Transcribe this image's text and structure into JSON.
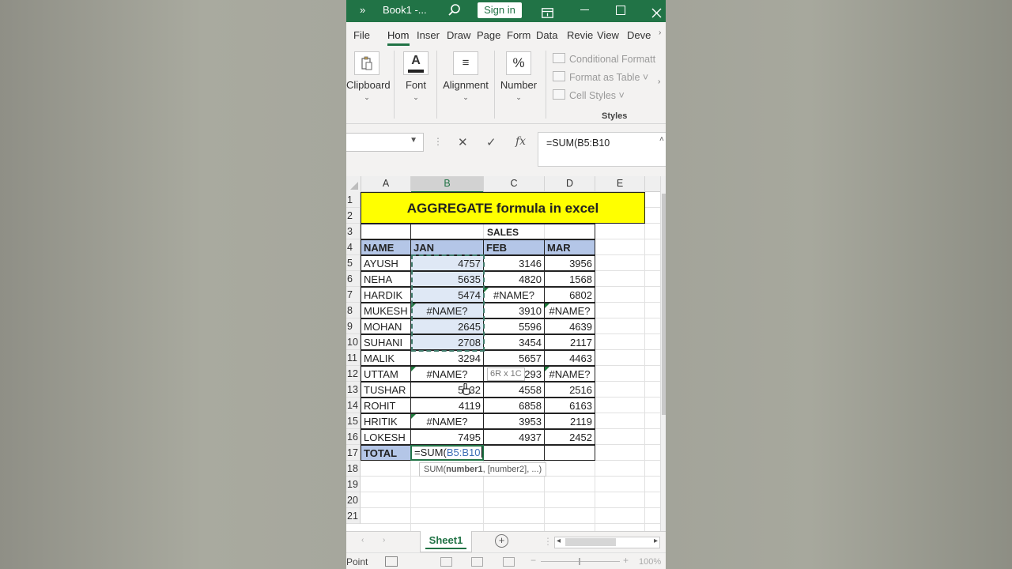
{
  "titlebar": {
    "chevron": "»",
    "doc_title": "Book1 -...",
    "signin_label": "Sign in",
    "icons": [
      "search-icon",
      "ribbon-display-icon",
      "minimize-icon",
      "maximize-icon",
      "close-icon"
    ],
    "accent": "#217346"
  },
  "tabs": [
    "File",
    "Hom",
    "Inser",
    "Draw",
    "Page",
    "Form",
    "Data",
    "Revie",
    "View",
    "Deve"
  ],
  "ribbon": {
    "clipboard": "Clipboard",
    "font": "Font",
    "alignment": "Alignment",
    "number": "Number",
    "styles_items": [
      "Conditional Formatt",
      "Format as Table ˅",
      "Cell Styles ˅"
    ],
    "styles_label": "Styles"
  },
  "formula_bar": {
    "fx": "fx",
    "formula": "=SUM(B5:B10"
  },
  "grid": {
    "columns": [
      "A",
      "B",
      "C",
      "D",
      "E"
    ],
    "rows": [
      "1",
      "2",
      "3",
      "4",
      "5",
      "6",
      "7",
      "8",
      "9",
      "10",
      "11",
      "12",
      "13",
      "14",
      "15",
      "16",
      "17",
      "18",
      "19",
      "20",
      "21"
    ],
    "title": "AGGREGATE formula in excel",
    "sales_header": "SALES",
    "table_headers": [
      "NAME",
      "JAN",
      "FEB",
      "MAR"
    ],
    "data": [
      [
        "AYUSH",
        "4757",
        "3146",
        "3956"
      ],
      [
        "NEHA",
        "5635",
        "4820",
        "1568"
      ],
      [
        "HARDIK",
        "5474",
        "#NAME?",
        "6802"
      ],
      [
        "MUKESH",
        "#NAME?",
        "3910",
        "#NAME?"
      ],
      [
        "MOHAN",
        "2645",
        "5596",
        "4639"
      ],
      [
        "SUHANI",
        "2708",
        "3454",
        "2117"
      ],
      [
        "MALIK",
        "3294",
        "5657",
        "4463"
      ],
      [
        "UTTAM",
        "#NAME?",
        "5293",
        "#NAME?"
      ],
      [
        "TUSHAR",
        "5132",
        "4558",
        "2516"
      ],
      [
        "ROHIT",
        "4119",
        "6858",
        "6163"
      ],
      [
        "HRITIK",
        "#NAME?",
        "3953",
        "2119"
      ],
      [
        "LOKESH",
        "7495",
        "4937",
        "2452"
      ]
    ],
    "total_label": "TOTAL",
    "total_formula_prefix": "=SUM(",
    "total_formula_ref": "B5:B10",
    "range_tooltip": "6R x 1C",
    "func_tooltip_prefix": "SUM(",
    "func_tooltip_bold": "number1",
    "func_tooltip_rest": ", [number2], ...)",
    "colors": {
      "title_fill": "#ffff00",
      "header_fill": "#b4c6e7",
      "total_fill": "#b4c6e7",
      "selection_fill": "#dfe8f5",
      "reference_blue": "#3d6fb6"
    }
  },
  "sheetbar": {
    "sheet_name": "Sheet1",
    "add_sheet": "+"
  },
  "statusbar": {
    "mode": "Point",
    "zoom": "100%"
  }
}
